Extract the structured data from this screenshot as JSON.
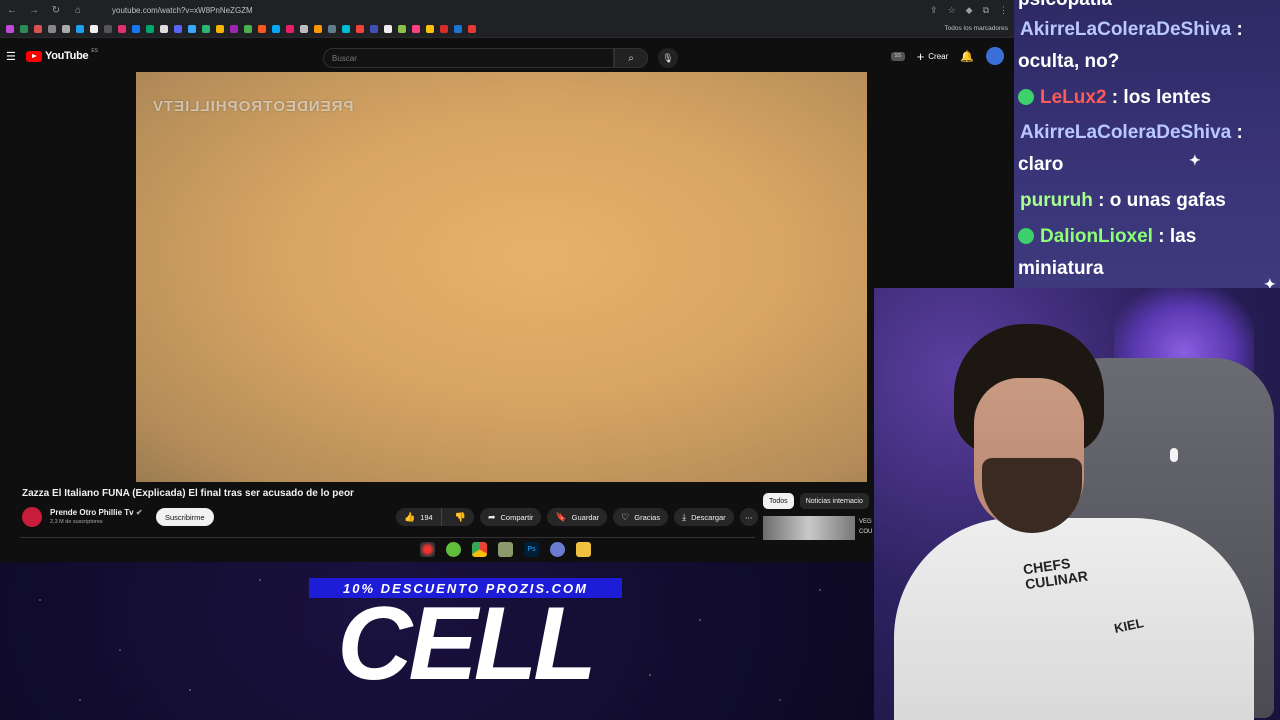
{
  "browser": {
    "url": "youtube.com/watch?v=xW8PnNeZGZM",
    "bookmarks_end": "Todos los marcadores"
  },
  "youtube": {
    "logo_text": "YouTube",
    "logo_region": "ES",
    "search_placeholder": "Buscar",
    "create_label": "Crear",
    "video_watermark": "PRENDEOTROPHILLIETV",
    "video_title": "Zazza El Italiano FUNA (Explicada) El final tras ser acusado de lo peor",
    "channel_name": "Prende Otro Phillie Tv",
    "subscribers": "2,3 M de suscriptores",
    "subscribe_label": "Suscribirme",
    "likes": "194",
    "share_label": "Compartir",
    "save_label": "Guardar",
    "thanks_label": "Gracias",
    "download_label": "Descargar",
    "chips": [
      "Todos",
      "Noticias internacio"
    ],
    "related_text_1": "VEG",
    "related_text_2": "COU"
  },
  "promo": {
    "top": "10% DESCUENTO PROZIS.COM",
    "big": "CELL"
  },
  "chat": {
    "partial_top": "psicopatia",
    "lines": [
      {
        "user": "AkirreLaColeraDeShiva",
        "sep": " :",
        "message": "oculta, no?"
      },
      {
        "user": "LeLux2",
        "sep": " :",
        "message": " los lentes"
      },
      {
        "user": "AkirreLaColeraDeShiva",
        "sep": " :",
        "message": "claro"
      },
      {
        "user": "pururuh",
        "sep": " :",
        "message": " o unas gafas"
      },
      {
        "user": "DalionLioxel",
        "sep": " :",
        "message": " las"
      },
      {
        "continuation": "miniatura"
      }
    ]
  },
  "webcam": {
    "shirt_text_1": "CHEFS",
    "shirt_text_2": "CULINAR",
    "shirt_text_3": "KIEL"
  },
  "colors": {
    "yt_red": "#ff0000",
    "promo_blue": "#1d1cd6",
    "chat_bg": "#2d2a64"
  }
}
